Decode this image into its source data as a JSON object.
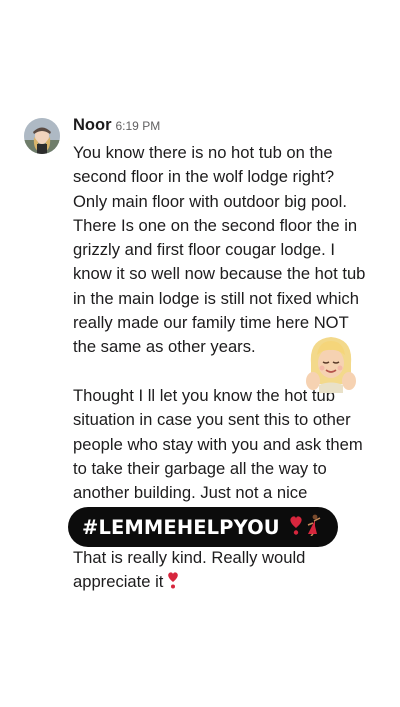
{
  "message": {
    "author": "Noor",
    "time": "6:19 PM",
    "paragraph1": [
      "You know there is no hot tub on the",
      "second floor in the wolf lodge right?",
      "Only main floor with outdoor big pool.",
      "There Is one on the second floor the in",
      "grizzly and first floor cougar lodge. I",
      "know it so well now  because the hot tub",
      "in the main lodge is still not fixed which",
      "really made our family time here NOT",
      "the same as other years."
    ],
    "paragraph2": [
      "Thought I ll let you know the hot tub",
      "situation in case you sent this to other",
      "people who stay with you and ask them",
      "to take their garbage all the way to",
      "another building. Just not a nice"
    ]
  },
  "sticker": {
    "hashtag": "#LEMMEHELPYOU",
    "emoji_icons": [
      "heart-exclamation-icon",
      "dancer-icon"
    ]
  },
  "caption": {
    "line1": "That is really kind. Really would",
    "line2": "appreciate it"
  },
  "colors": {
    "background": "#ffffff",
    "text": "#1d1c1d",
    "timestamp": "#616061",
    "sticker_bg": "#0c0c0c",
    "heart": "#d7263d"
  }
}
